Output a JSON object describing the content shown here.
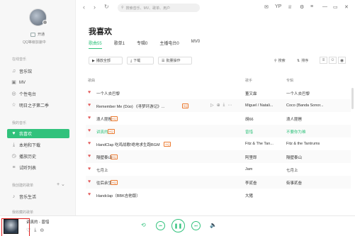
{
  "sidebar": {
    "vip_label": "开通",
    "qq_line": "QQ等级加速中",
    "sections": {
      "online": "在线音乐",
      "mine": "我的音乐",
      "created": "我创建的歌单",
      "collected": "我收藏的歌单"
    },
    "online_items": [
      {
        "label": "音乐馆",
        "icon": "music-hall-icon"
      },
      {
        "label": "MV",
        "icon": "mv-icon"
      },
      {
        "label": "个性电台",
        "icon": "radio-icon"
      },
      {
        "label": "明日之子第二季",
        "icon": "star-icon"
      }
    ],
    "mine_items": [
      {
        "label": "我喜欢",
        "icon": "heart-icon"
      },
      {
        "label": "本地和下载",
        "icon": "download-icon"
      },
      {
        "label": "播放历史",
        "icon": "history-icon"
      },
      {
        "label": "试听列表",
        "icon": "list-icon"
      }
    ],
    "created_items": [
      {
        "label": "音乐生活",
        "icon": "music-note-icon"
      }
    ]
  },
  "topbar": {
    "search_placeholder": "搜索音乐、MV、歌单、用户",
    "vip_badge": "YP"
  },
  "main": {
    "title": "我喜欢",
    "tabs": [
      "歌曲55",
      "歌单1",
      "专辑0",
      "主播电台0",
      "MV0"
    ],
    "play_all": "播放全部",
    "download": "下载",
    "batch": "批量操作",
    "search": "搜索",
    "sort": "排序",
    "columns": {
      "song": "歌曲",
      "singer": "歌手",
      "album": "专辑"
    }
  },
  "songs": [
    {
      "title": "一个人去巴黎",
      "badge": "",
      "singer": "董又霖",
      "album": "一个人去巴黎"
    },
    {
      "title": "Remember Me (Dúo) 《寻梦环游记》...",
      "badge": "SQ",
      "singer": "Miguel / Natali...",
      "album": "Coco (Banda Sonor..."
    },
    {
      "title": "浪人琵琶",
      "badge": "HQ",
      "singer": "胡66",
      "album": "浪人琵琶"
    },
    {
      "title": "讲真的",
      "badge": "HQ",
      "singer": "曾惜",
      "album": "不要你为难"
    },
    {
      "title": "HandClap 吃鸡战歌!绝地求生跑BGM",
      "badge": "HQ",
      "singer": "Fitz & The Tan...",
      "album": "Fitz & the Tantrums"
    },
    {
      "title": "隔壁泰山",
      "badge": "HQ",
      "singer": "阿里郎",
      "album": "隔壁泰山"
    },
    {
      "title": "七月上",
      "badge": "",
      "singer": "Jam",
      "album": "七月上"
    },
    {
      "title": "往后余生",
      "badge": "HQ",
      "singer": "李贰叁",
      "album": "街事贰叁"
    },
    {
      "title": "Handclap（BBK吉他版）",
      "badge": "",
      "singer": "大猪",
      "album": ""
    }
  ],
  "player": {
    "now_title": "讲真的 - 曾惜"
  },
  "colors": {
    "accent": "#31c27c",
    "heart": "#e35c5c",
    "badge": "#ec7a2f",
    "highlight_box": "#e02020"
  }
}
